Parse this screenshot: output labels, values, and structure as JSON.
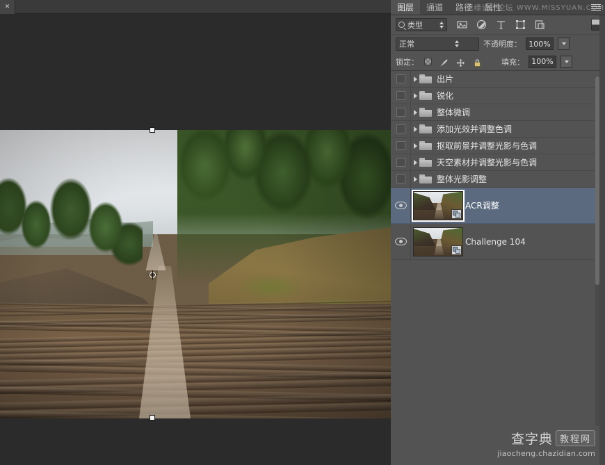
{
  "document": {
    "tab_close_icon": "close-icon"
  },
  "panel": {
    "tabs": [
      {
        "label": "图层",
        "active": true
      },
      {
        "label": "通道",
        "active": false
      },
      {
        "label": "路径",
        "active": false
      },
      {
        "label": "属性",
        "active": false
      }
    ],
    "menu_icon": "panel-menu-icon",
    "filter": {
      "search_icon": "search-icon",
      "type_label": "类型",
      "spinner_icon": "spinner-icon",
      "icons": [
        {
          "name": "pixel-layer-filter-icon"
        },
        {
          "name": "adjustment-layer-filter-icon"
        },
        {
          "name": "type-layer-filter-icon"
        },
        {
          "name": "shape-layer-filter-icon"
        },
        {
          "name": "smart-object-filter-icon"
        }
      ],
      "toggle_name": "filter-toggle-switch"
    },
    "blend": {
      "mode": "正常",
      "opacity_label": "不透明度：",
      "opacity_value": "100%"
    },
    "lock": {
      "label": "锁定：",
      "icons": [
        {
          "name": "lock-transparent-pixels-icon"
        },
        {
          "name": "lock-image-pixels-icon"
        },
        {
          "name": "lock-position-icon"
        },
        {
          "name": "lock-all-icon"
        }
      ],
      "fill_label": "填充：",
      "fill_value": "100%"
    },
    "layers": [
      {
        "name": "出片",
        "type": "group",
        "visible": false,
        "selected": false,
        "expanded": false
      },
      {
        "name": "锐化",
        "type": "group",
        "visible": false,
        "selected": false,
        "expanded": false
      },
      {
        "name": "整体微调",
        "type": "group",
        "visible": false,
        "selected": false,
        "expanded": false
      },
      {
        "name": "添加光效并调整色调",
        "type": "group",
        "visible": false,
        "selected": false,
        "expanded": false
      },
      {
        "name": "抠取前景并调整光影与色调",
        "type": "group",
        "visible": false,
        "selected": false,
        "expanded": false
      },
      {
        "name": "天空素材并调整光影与色调",
        "type": "group",
        "visible": false,
        "selected": false,
        "expanded": false
      },
      {
        "name": "整体光影调整",
        "type": "group",
        "visible": false,
        "selected": false,
        "expanded": false
      },
      {
        "name": "ACR调整",
        "type": "image",
        "visible": true,
        "selected": true,
        "smart_object": true
      },
      {
        "name": "Challenge 104",
        "type": "image",
        "visible": true,
        "selected": false,
        "smart_object": true
      }
    ]
  },
  "watermarks": {
    "top_cn": "思缘设计论坛",
    "top_en": "WWW.MISSYUAN.COM",
    "bottom_main": "查字典",
    "bottom_badge": "教程网",
    "bottom_url": "jiaocheng.chazidian.com"
  },
  "colors": {
    "panel_bg": "#535353",
    "selected_row": "#5c6a7f",
    "text": "#e6e6e6",
    "canvas_bg": "#2b2b2b"
  }
}
